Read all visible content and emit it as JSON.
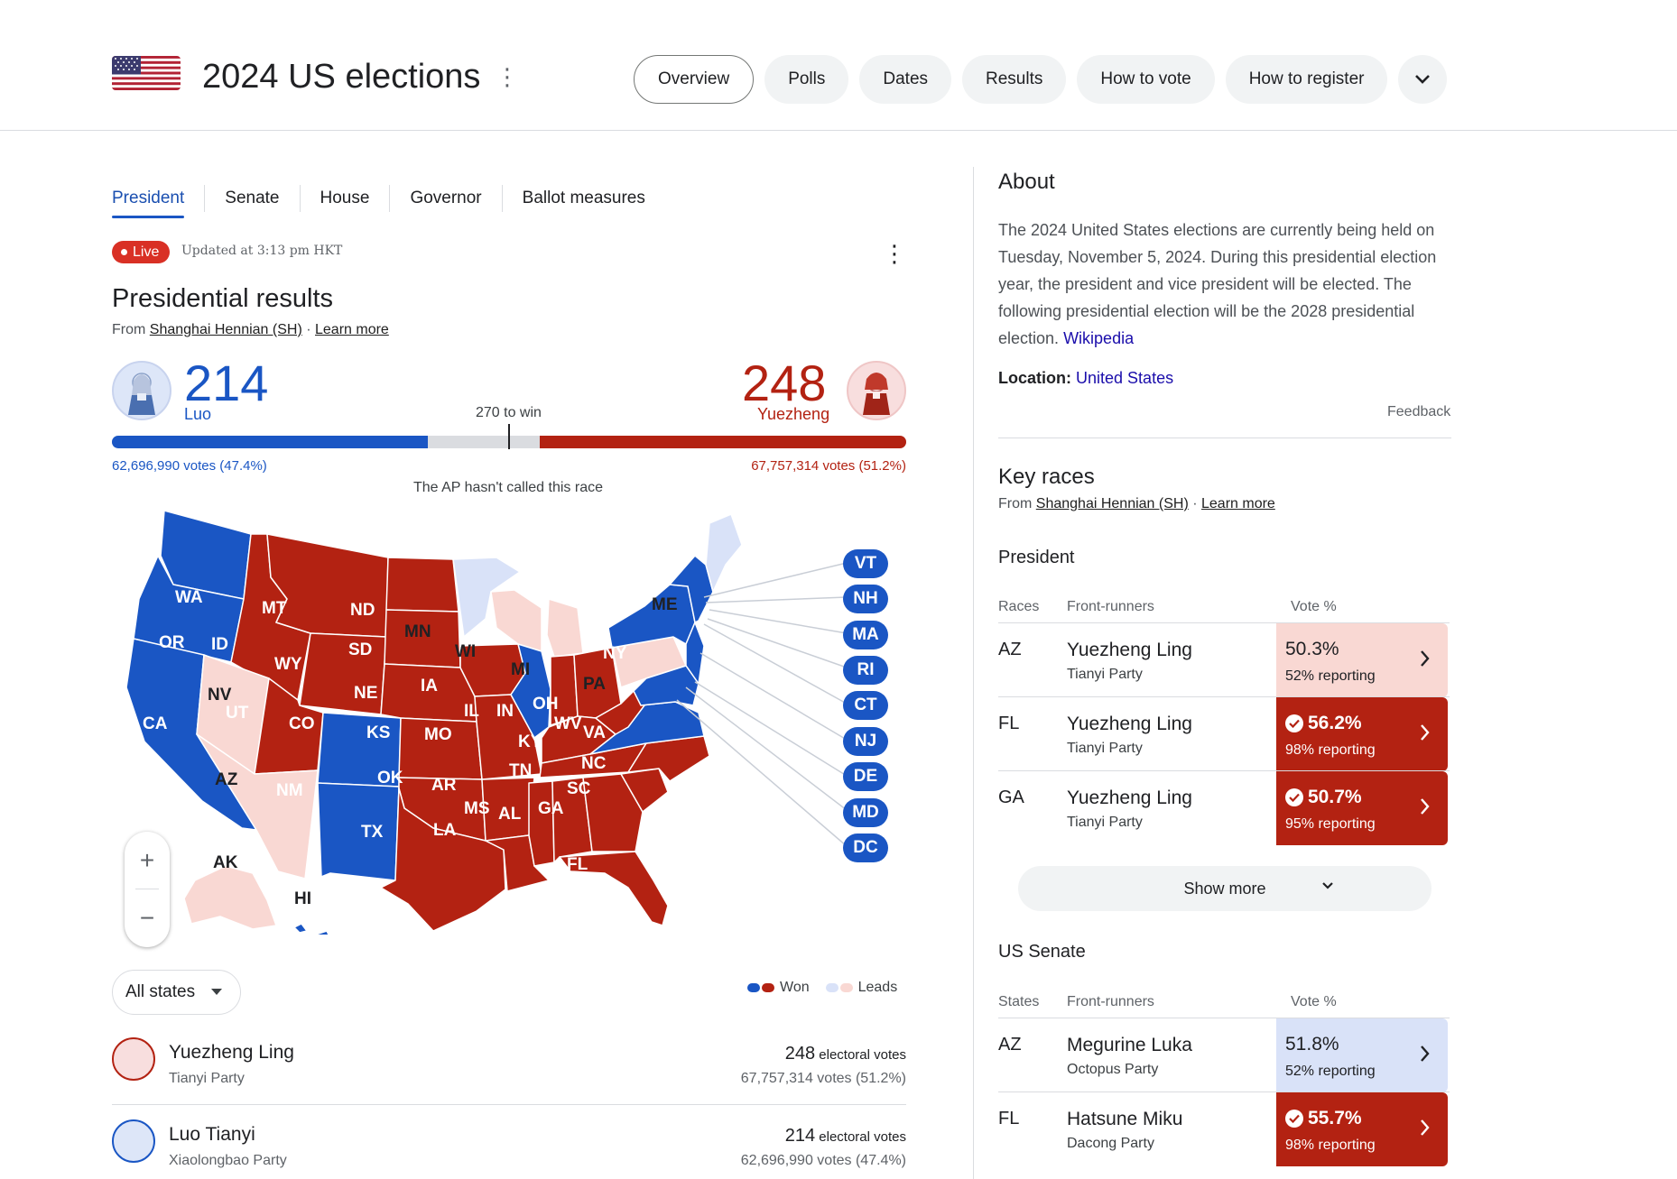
{
  "header": {
    "title": "2024 US elections",
    "nav": [
      "Overview",
      "Polls",
      "Dates",
      "Results",
      "How to vote",
      "How to register"
    ],
    "active_nav": "Overview"
  },
  "subtabs": [
    "President",
    "Senate",
    "House",
    "Governor",
    "Ballot measures"
  ],
  "live": {
    "badge": "Live",
    "updated": "Updated at 3:13 pm HKT"
  },
  "results": {
    "title": "Presidential results",
    "source_prefix": "From",
    "source_name": "Shanghai Hennian (SH)",
    "learn_more": "Learn more",
    "to_win": "270 to win",
    "ap_note": "The AP hasn't called this race",
    "blue": {
      "short_name": "Luo",
      "electoral": "214",
      "votes": "62,696,990 votes (47.4%)",
      "ev_value": 214
    },
    "red": {
      "short_name": "Yuezheng",
      "electoral": "248",
      "votes": "67,757,314 votes (51.2%)",
      "ev_value": 248
    },
    "total_ev": 538,
    "win_threshold": 270
  },
  "map": {
    "states_won_blue": [
      "WA",
      "OR",
      "CA",
      "CO",
      "NM",
      "IL",
      "VA",
      "NY"
    ],
    "states_lead_blue": [
      "MN",
      "ME"
    ],
    "states_won_red": [
      "MT",
      "ID",
      "WY",
      "ND",
      "SD",
      "NE",
      "KS",
      "UT",
      "OK",
      "TX",
      "IA",
      "MO",
      "AR",
      "LA",
      "MS",
      "AL",
      "GA",
      "FL",
      "SC",
      "NC",
      "TN",
      "KY",
      "IN",
      "OH",
      "WV"
    ],
    "states_lead_red": [
      "NV",
      "AZ",
      "WI",
      "MI",
      "PA",
      "AK"
    ],
    "labels": {
      "WA": "WA",
      "OR": "OR",
      "CA": "CA",
      "NV": "NV",
      "ID": "ID",
      "MT": "MT",
      "WY": "WY",
      "UT": "UT",
      "AZ": "AZ",
      "CO": "CO",
      "NM": "NM",
      "ND": "ND",
      "SD": "SD",
      "NE": "NE",
      "KS": "KS",
      "OK": "OK",
      "TX": "TX",
      "MN": "MN",
      "IA": "IA",
      "MO": "MO",
      "AR": "AR",
      "LA": "LA",
      "WI": "WI",
      "IL": "IL",
      "MI": "MI",
      "IN": "IN",
      "KY": "KY",
      "TN": "TN",
      "MS": "MS",
      "AL": "AL",
      "GA": "GA",
      "FL": "FL",
      "SC": "SC",
      "NC": "NC",
      "VA": "VA",
      "WV": "WV",
      "OH": "OH",
      "PA": "PA",
      "NY": "NY",
      "ME": "ME",
      "AK": "AK",
      "HI": "HI"
    },
    "small_states": [
      "VT",
      "NH",
      "MA",
      "RI",
      "CT",
      "NJ",
      "DE",
      "MD",
      "DC"
    ],
    "zoom_in": "+",
    "zoom_out": "−",
    "filter": "All states",
    "legend_won": "Won",
    "legend_leads": "Leads"
  },
  "candidates": [
    {
      "name": "Yuezheng Ling",
      "party": "Tianyi Party",
      "electoral": "248",
      "ev_suffix": "electoral votes",
      "votes": "67,757,314 votes (51.2%)"
    },
    {
      "name": "Luo Tianyi",
      "party": "Xiaolongbao Party",
      "electoral": "214",
      "ev_suffix": "electoral votes",
      "votes": "62,696,990 votes (47.4%)"
    }
  ],
  "about": {
    "title": "About",
    "text": "The 2024 United States elections are currently being held on Tuesday, November 5, 2024. During this presidential election year, the president and vice president will be elected. The following presidential election will be the 2028 presidential election.",
    "wiki": "Wikipedia",
    "location_label": "Location:",
    "location_value": "United States",
    "feedback": "Feedback"
  },
  "key_races": {
    "title": "Key races",
    "source_prefix": "From",
    "source_name": "Shanghai Hennian (SH)",
    "learn_more": "Learn more",
    "president": {
      "title": "President",
      "headers": [
        "Races",
        "Front-runners",
        "Vote %"
      ],
      "rows": [
        {
          "state": "AZ",
          "name": "Yuezheng Ling",
          "party": "Tianyi Party",
          "pct": "50.3%",
          "reporting": "52% reporting",
          "won": false
        },
        {
          "state": "FL",
          "name": "Yuezheng Ling",
          "party": "Tianyi Party",
          "pct": "56.2%",
          "reporting": "98% reporting",
          "won": true
        },
        {
          "state": "GA",
          "name": "Yuezheng Ling",
          "party": "Tianyi Party",
          "pct": "50.7%",
          "reporting": "95% reporting",
          "won": true
        }
      ]
    },
    "show_more": "Show more",
    "senate": {
      "title": "US Senate",
      "headers": [
        "States",
        "Front-runners",
        "Vote %"
      ],
      "rows": [
        {
          "state": "AZ",
          "name": "Megurine Luka",
          "party": "Octopus Party",
          "pct": "51.8%",
          "reporting": "52% reporting",
          "won": false
        },
        {
          "state": "FL",
          "name": "Hatsune Miku",
          "party": "Dacong Party",
          "pct": "55.7%",
          "reporting": "98% reporting",
          "won": true
        }
      ]
    }
  },
  "colors": {
    "blue_won": "#1a56c4",
    "red_won": "#b32212",
    "blue_lead": "#d9e2f8",
    "red_lead": "#f9d8d3"
  }
}
